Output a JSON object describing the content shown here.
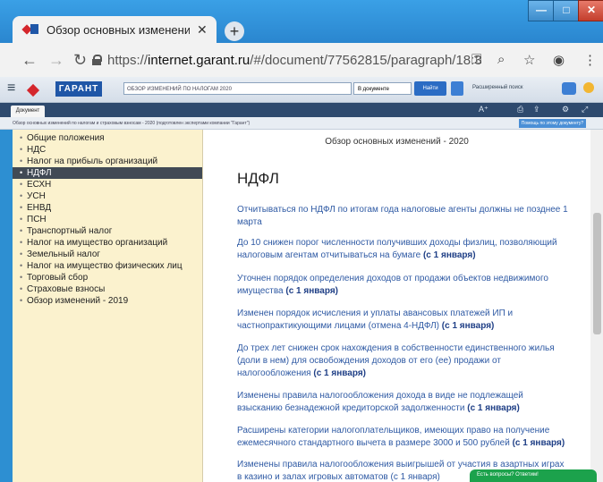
{
  "browser": {
    "tab_title": "Обзор основных изменений по",
    "tab_close": "✕",
    "new_tab": "+",
    "url_prefix": "https://",
    "url_host": "internet.garant.ru",
    "url_path": "/#/document/77562815/paragraph/18:3",
    "window_controls": {
      "minimize": "—",
      "maximize": "□",
      "close": "✕"
    }
  },
  "garant_toolbar": {
    "logo_text": "ГАРАНТ",
    "search_value": "ОБЗОР ИЗМЕНЕНИЙ ПО НАЛОГАМ 2020",
    "scope_select": "В документе",
    "find_button": "Найти",
    "advanced_search": "Расширенный поиск"
  },
  "doc_toolbar": {
    "tab_label": "Документ",
    "breadcrumb": "Обзор основных изменений по налогам и страховым взносам - 2020 (подготовлен экспертами компании \"Гарант\")",
    "help_button": "Помощь по этому документу?"
  },
  "sidebar": {
    "items": [
      {
        "label": "Общие положения",
        "active": false
      },
      {
        "label": "НДС",
        "active": false
      },
      {
        "label": "Налог на прибыль организаций",
        "active": false
      },
      {
        "label": "НДФЛ",
        "active": true
      },
      {
        "label": "ЕСХН",
        "active": false
      },
      {
        "label": "УСН",
        "active": false
      },
      {
        "label": "ЕНВД",
        "active": false
      },
      {
        "label": "ПСН",
        "active": false
      },
      {
        "label": "Транспортный налог",
        "active": false
      },
      {
        "label": "Налог на имущество организаций",
        "active": false
      },
      {
        "label": "Земельный налог",
        "active": false
      },
      {
        "label": "Налог на имущество физических лиц",
        "active": false
      },
      {
        "label": "Торговый сбор",
        "active": false
      },
      {
        "label": "Страховые взносы",
        "active": false
      },
      {
        "label": "Обзор изменений - 2019",
        "active": false
      }
    ]
  },
  "main": {
    "header": "Обзор основных изменений - 2020",
    "title": "НДФЛ",
    "paragraphs": [
      {
        "text": "Отчитываться по НДФЛ по итогам года налоговые агенты должны не позднее 1 марта",
        "tag": ""
      },
      {
        "text": "До 10 снижен порог численности получивших доходы физлиц, позволяющий налоговым агентам отчитываться на бумаге",
        "tag": "(с 1 января)"
      },
      {
        "text": "Уточнен порядок определения доходов от продажи объектов недвижимого имущества",
        "tag": "(с 1 января)"
      },
      {
        "text": "Изменен порядок исчисления и уплаты авансовых платежей ИП и частнопрактикующими лицами (отмена 4-НДФЛ)",
        "tag": "(с 1 января)"
      },
      {
        "text": "До трех лет снижен срок нахождения в собственности единственного жилья (доли в нем) для освобождения доходов от его (ее) продажи от налогообложения",
        "tag": "(с 1 января)"
      },
      {
        "text": "Изменены правила налогообложения дохода в виде не подлежащей взысканию безнадежной кредиторской задолженности",
        "tag": "(с 1 января)"
      },
      {
        "text": "Расширены категории налогоплательщиков, имеющих право на получение ежемесячного стандартного вычета в размере 3000 и 500 рублей",
        "tag": "(с 1 января)"
      },
      {
        "text": "Изменены правила налогообложения выигрышей от участия в азартных играх в казино и залах игровых автоматов (с 1 января)",
        "tag": ""
      }
    ]
  },
  "chat": {
    "label": "Есть вопросы? Ответим!"
  }
}
